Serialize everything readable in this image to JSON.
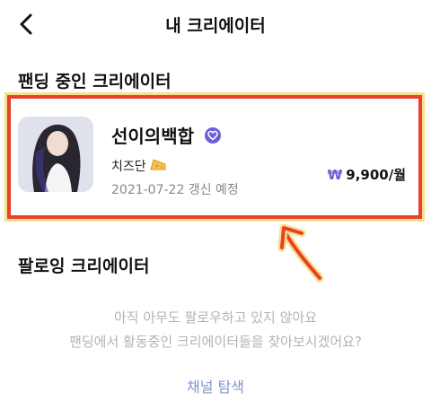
{
  "header": {
    "title": "내 크리에이터",
    "back_icon": "chevron-left-icon"
  },
  "funding": {
    "section_title": "팬딩 중인 크리에이터",
    "creator": {
      "name": "선이의백합",
      "tier": "치즈단",
      "renewal": "2021-07-22 갱신 예정",
      "currency_symbol": "₩",
      "price": "9,900/월",
      "verified_icon": "verified-heart-badge-icon",
      "tier_icon": "cheese-icon"
    }
  },
  "following": {
    "section_title": "팔로잉 크리에이터",
    "empty_line1": "아직 아무도 팔로우하고 있지 않아요",
    "empty_line2": "팬딩에서 활동중인 크리에이터들을 찾아보시겠어요?",
    "link_label": "채널 탐색"
  },
  "colors": {
    "accent": "#6a5fd6",
    "highlight_border": "#e8402c",
    "highlight_glow": "#f7e08a",
    "link": "#7f95c9"
  }
}
